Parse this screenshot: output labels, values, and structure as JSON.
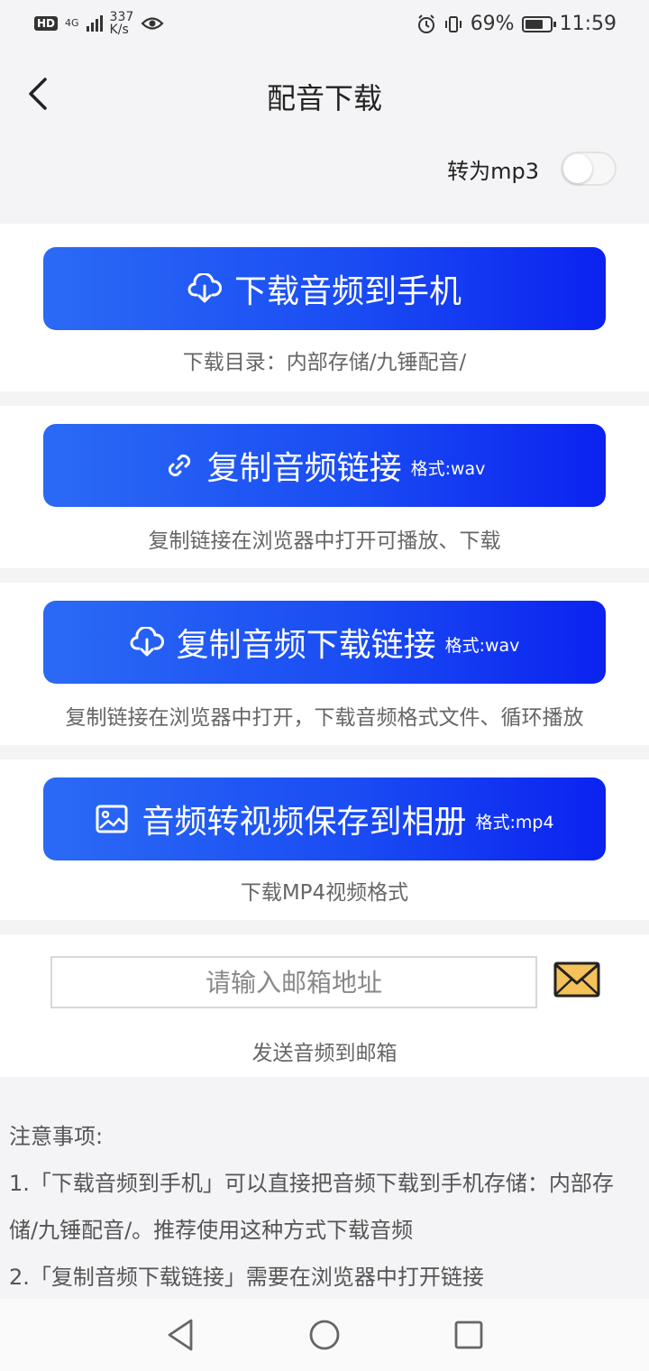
{
  "status_bar": {
    "hd": "HD",
    "network": "4G",
    "speed_value": "337",
    "speed_unit": "K/s",
    "battery": "69%",
    "time": "11:59"
  },
  "header": {
    "title": "配音下载"
  },
  "convert_mp3": {
    "label": "转为mp3",
    "enabled": false
  },
  "actions": [
    {
      "label": "下载音频到手机",
      "format": "",
      "icon": "cloud-download-icon",
      "note": "下载目录：内部存储/九锤配音/"
    },
    {
      "label": "复制音频链接",
      "format": "格式:wav",
      "icon": "link-icon",
      "note": "复制链接在浏览器中打开可播放、下载"
    },
    {
      "label": "复制音频下载链接",
      "format": "格式:wav",
      "icon": "cloud-download-icon",
      "note": "复制链接在浏览器中打开，下载音频格式文件、循环播放"
    },
    {
      "label": "音频转视频保存到相册",
      "format": "格式:mp4",
      "icon": "image-icon",
      "note": "下载MP4视频格式"
    }
  ],
  "email": {
    "placeholder": "请输入邮箱地址",
    "value": "",
    "note": "发送音频到邮箱",
    "icon": "envelope-icon"
  },
  "notices": {
    "heading": "注意事项:",
    "items": [
      "1.「下载音频到手机」可以直接把音频下载到手机存储：内部存储/九锤配音/。推荐使用这种方式下载音频",
      "2.「复制音频下载链接」需要在浏览器中打开链接"
    ]
  },
  "colors": {
    "button_start": "#2b6af5",
    "button_end": "#0b22f0",
    "background": "#f4f4f6"
  }
}
